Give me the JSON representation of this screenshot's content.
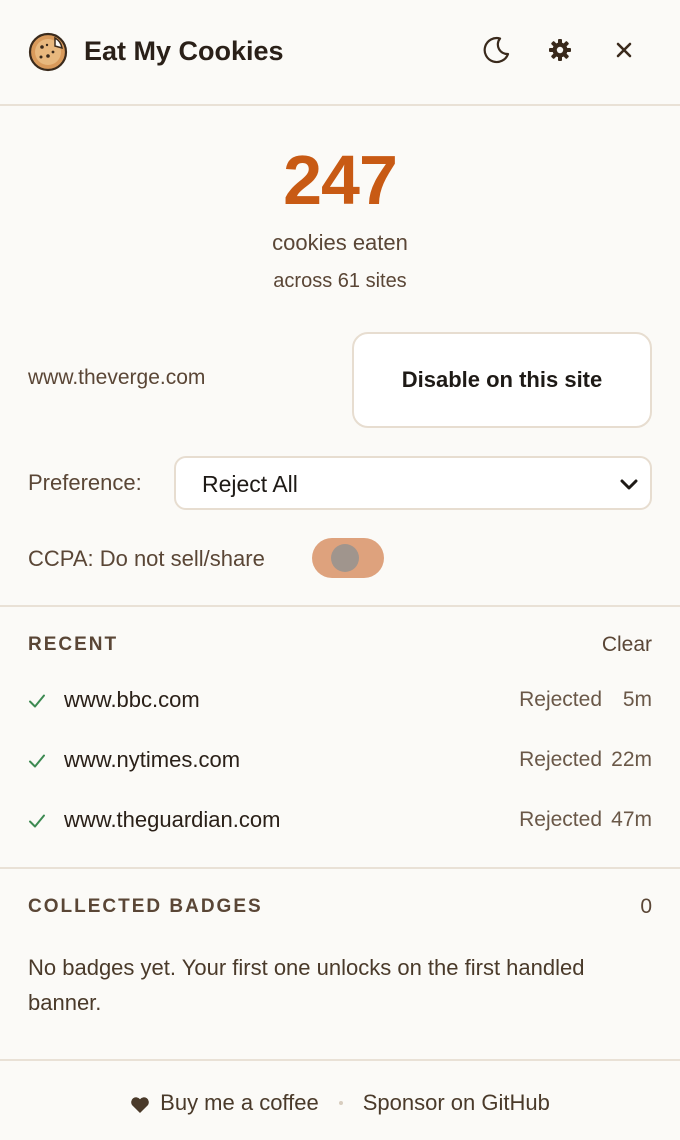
{
  "header": {
    "title": "Eat My Cookies",
    "icons": {
      "logo": "cookie-logo",
      "theme": "moon-icon",
      "settings": "gear-icon",
      "close": "close-icon"
    }
  },
  "stats": {
    "count": "247",
    "label": "cookies eaten",
    "sites": "across 61 sites"
  },
  "site": {
    "domain": "www.theverge.com",
    "disable_label": "Disable on this site"
  },
  "preference": {
    "label": "Preference:",
    "value": "Reject All"
  },
  "ccpa": {
    "label": "CCPA: Do not sell/share",
    "enabled": false
  },
  "recent": {
    "title": "RECENT",
    "clear_label": "Clear",
    "items": [
      {
        "domain": "www.bbc.com",
        "status": "Rejected",
        "time": "5m"
      },
      {
        "domain": "www.nytimes.com",
        "status": "Rejected",
        "time": "22m"
      },
      {
        "domain": "www.theguardian.com",
        "status": "Rejected",
        "time": "47m"
      }
    ]
  },
  "badges": {
    "title": "COLLECTED BADGES",
    "count": "0",
    "empty_text": "No badges yet. Your first one unlocks on the first handled banner."
  },
  "footer": {
    "coffee_label": "Buy me a coffee",
    "sponsor_label": "Sponsor on GitHub"
  },
  "colors": {
    "accent": "#c85a14",
    "toggle_track": "#dea27d",
    "check_green": "#3d8a52",
    "background": "#fbfaf7"
  }
}
